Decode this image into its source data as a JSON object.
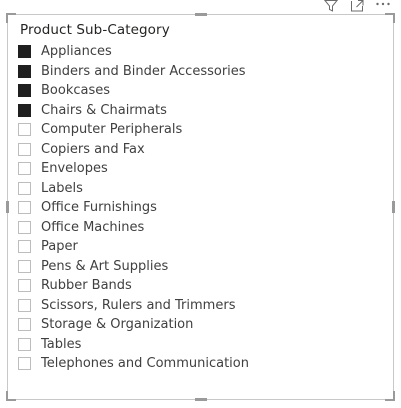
{
  "toolbar": {
    "icons": [
      "filter-icon",
      "focus-mode-icon",
      "more-options-icon"
    ],
    "more_label": "···"
  },
  "slicer": {
    "title": "Product Sub-Category",
    "items": [
      {
        "label": "Appliances",
        "checked": true
      },
      {
        "label": "Binders and Binder Accessories",
        "checked": true
      },
      {
        "label": "Bookcases",
        "checked": true
      },
      {
        "label": "Chairs & Chairmats",
        "checked": true
      },
      {
        "label": "Computer Peripherals",
        "checked": false
      },
      {
        "label": "Copiers and Fax",
        "checked": false
      },
      {
        "label": "Envelopes",
        "checked": false
      },
      {
        "label": "Labels",
        "checked": false
      },
      {
        "label": "Office Furnishings",
        "checked": false
      },
      {
        "label": "Office Machines",
        "checked": false
      },
      {
        "label": "Paper",
        "checked": false
      },
      {
        "label": "Pens & Art Supplies",
        "checked": false
      },
      {
        "label": "Rubber Bands",
        "checked": false
      },
      {
        "label": "Scissors, Rulers and Trimmers",
        "checked": false
      },
      {
        "label": "Storage & Organization",
        "checked": false
      },
      {
        "label": "Tables",
        "checked": false
      },
      {
        "label": "Telephones and Communication",
        "checked": false
      }
    ]
  },
  "colors": {
    "checked_fill": "#1f1f1f",
    "unchecked_border": "#bdbdbd",
    "title_text": "#252423",
    "item_text": "#404040",
    "frame_border": "#c8c8c8"
  }
}
